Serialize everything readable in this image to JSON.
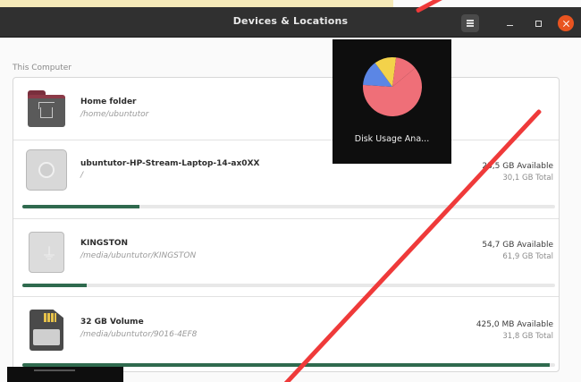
{
  "window": {
    "title": "Devices & Locations"
  },
  "section": {
    "label": "This Computer"
  },
  "locations": [
    {
      "name": "Home folder",
      "path": "/home/ubuntutor",
      "icon": "home-folder-icon"
    },
    {
      "name": "ubuntutor-HP-Stream-Laptop-14-ax0XX",
      "path": "/",
      "available": "23,5 GB Available",
      "total": "30,1 GB Total",
      "usage_fraction": 0.22,
      "icon": "hard-drive-icon"
    },
    {
      "name": "KINGSTON",
      "path": "/media/ubuntutor/KINGSTON",
      "available": "54,7 GB Available",
      "total": "61,9 GB Total",
      "usage_fraction": 0.12,
      "icon": "usb-drive-icon"
    },
    {
      "name": "32 GB Volume",
      "path": "/media/ubuntutor/9016-4EF8",
      "available": "425,0 MB Available",
      "total": "31,8 GB Total",
      "usage_fraction": 0.99,
      "icon": "sd-card-icon"
    }
  ],
  "popup": {
    "label": "Disk Usage Ana...",
    "icon": "disk-usage-analyzer-icon",
    "pie_colors": [
      "#ef6f78",
      "#5b86e5",
      "#f3d24a",
      "#79c24b"
    ]
  },
  "colors": {
    "headerbar": "#303030",
    "usage_bar": "#2f6a4e",
    "close_button": "#e95420",
    "annotation": "#ef3a3a"
  }
}
